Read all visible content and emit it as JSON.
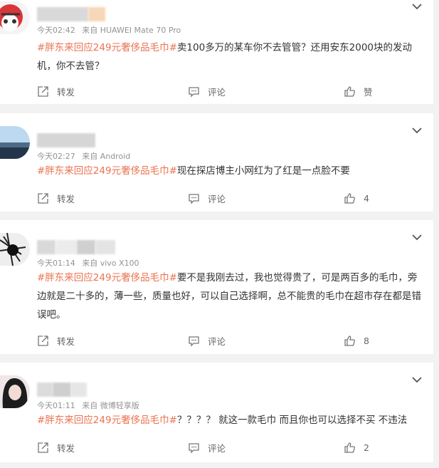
{
  "posts": [
    {
      "username_hidden": "",
      "time": "今天02:42",
      "source": "来自 HUAWEI Mate 70 Pro",
      "hashtag": "#胖东来回应249元奢侈品毛巾#",
      "text": "卖100多万的某车你不去管管？还用安东2000块的发动机，你不去管？",
      "forward_label": "转发",
      "comment_label": "评论",
      "like_label": "赞"
    },
    {
      "time": "今天02:27",
      "source": "来自 Android",
      "hashtag": "#胖东来回应249元奢侈品毛巾#",
      "text": "现在探店博主小网红为了红是一点脸不要",
      "forward_label": "转发",
      "comment_label": "评论",
      "like_label": "4"
    },
    {
      "time": "今天01:14",
      "source": "来自 vivo X100",
      "hashtag": "#胖东来回应249元奢侈品毛巾#",
      "text": "要不是我刚去过，我也觉得贵了，可是两百多的毛巾，旁边就是二十多的，薄一些，质量也好，可以自己选择啊，总不能贵的毛巾在超市存在都是错误吧。",
      "forward_label": "转发",
      "comment_label": "评论",
      "like_label": "8"
    },
    {
      "time": "今天01:11",
      "source": "来自 微博轻享版",
      "hashtag": "#胖东来回应249元奢侈品毛巾#",
      "text": "？？？？ 就这一款毛巾 而且你也可以选择不买 不违法",
      "forward_label": "转发",
      "comment_label": "评论",
      "like_label": "2"
    }
  ],
  "colors": {
    "hashtag": "#eb7350",
    "meta": "#939393",
    "action": "#666666",
    "background": "#f2f2f2"
  },
  "icons": [
    "avatar",
    "chevron-down-icon",
    "forward-icon",
    "comment-icon",
    "like-icon"
  ]
}
